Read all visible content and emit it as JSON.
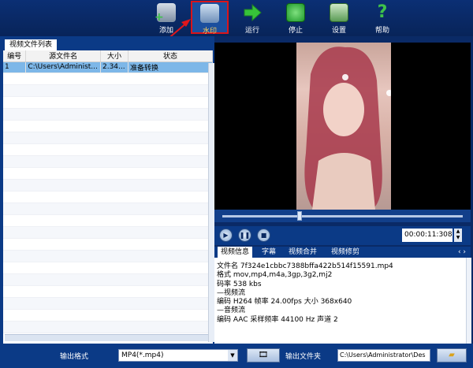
{
  "toolbar": {
    "add_label": "添加",
    "watermark_label": "水印",
    "run_label": "运行",
    "stop_label": "停止",
    "settings_label": "设置",
    "help_label": "帮助"
  },
  "file_list": {
    "tab_label": "视频文件列表",
    "columns": [
      "编号",
      "源文件名",
      "大小",
      "状态"
    ],
    "rows": [
      {
        "id": "1",
        "name": "C:\\Users\\Administ...",
        "size": "2.34...",
        "status": "准备转换"
      }
    ]
  },
  "player": {
    "timecode": "00:00:11:308",
    "progress_fraction": 0.32
  },
  "info_tabs": [
    "视频信息",
    "字幕",
    "视频合并",
    "视频修剪"
  ],
  "info_nav": "‹ ›",
  "video_info": {
    "line1": "文件名  7f324e1cbbc7388bffa422b514f15591.mp4",
    "line2": "格式  mov,mp4,m4a,3gp,3g2,mj2",
    "line3": "码率  538 kbs",
    "line4": "—视频流",
    "line5": "编码  H264   帧率  24.00fps   大小  368x640",
    "line6": "—音频流",
    "line7": "编码  AAC   采样频率  44100 Hz   声道  2"
  },
  "bottom": {
    "output_format_label": "输出格式",
    "output_format_value": "MP4(*.mp4)",
    "output_folder_label": "输出文件夹",
    "output_folder_value": "C:\\Users\\Administrator\\Des"
  },
  "colors": {
    "toolbar_bg": "#082459",
    "panel_bg": "#0b3a86",
    "selected_row": "#7db7e8",
    "highlight_border": "#d9151a"
  }
}
